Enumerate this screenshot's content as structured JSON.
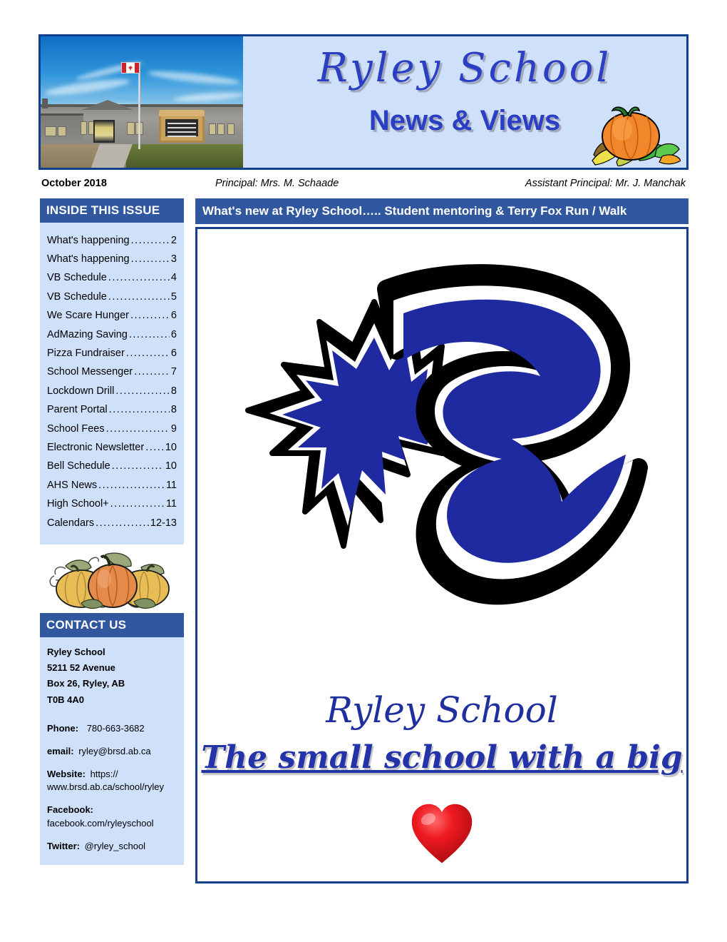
{
  "masthead": {
    "title": "Ryley School",
    "subtitle": "News & Views",
    "photo_alt": "ryley-school-building-photo",
    "pumpkin_alt": "autumn-pumpkin-clipart"
  },
  "byline": {
    "issue_date": "October 2018",
    "principal": "Principal: Mrs. M. Schaade",
    "assistant_principal": "Assistant Principal: Mr. J. Manchak"
  },
  "sidebar": {
    "toc_heading": "INSIDE THIS ISSUE",
    "toc": [
      {
        "label": "What's happening",
        "dots": "............",
        "page": "2"
      },
      {
        "label": "What's happening",
        "dots": "............",
        "page": "3"
      },
      {
        "label": "VB Schedule",
        "dots": "....................",
        "page": "4"
      },
      {
        "label": "VB Schedule",
        "dots": "....................",
        "page": "5"
      },
      {
        "label": "We Scare Hunger",
        "dots": "............",
        "page": "6"
      },
      {
        "label": "AdMazing Saving",
        "dots": "............",
        "page": "6"
      },
      {
        "label": "Pizza Fundraiser",
        "dots": ".............",
        "page": "6"
      },
      {
        "label": "School Messenger",
        "dots": "...........",
        "page": "7"
      },
      {
        "label": "Lockdown Drill",
        "dots": ".................",
        "page": "8"
      },
      {
        "label": "Parent Portal",
        "dots": "...................",
        "page": "8"
      },
      {
        "label": "School Fees",
        "dots": "....................",
        "page": "9"
      },
      {
        "label": "Electronic Newsletter",
        "dots": ".....",
        "page": "10"
      },
      {
        "label": "Bell Schedule",
        "dots": "................",
        "page": "10"
      },
      {
        "label": "AHS News",
        "dots": ".....................",
        "page": "11"
      },
      {
        "label": "High School+",
        "dots": ".................",
        "page": "11"
      },
      {
        "label": "Calendars",
        "dots": ".................",
        "page": "12-13"
      }
    ],
    "pumpkin_alt": "three-pumpkins-clipart",
    "contact_heading": "CONTACT US",
    "contact": {
      "school_name": "Ryley School",
      "street": "5211 52 Avenue",
      "box_city": "Box 26, Ryley,  AB",
      "postal": "T0B 4A0",
      "phone_label": "Phone:",
      "phone_value": "780-663-3682",
      "email_label": "email:",
      "email_value": "ryley@brsd.ab.ca",
      "website_label": "Website:",
      "website_value": "https://",
      "website_value2": "www.brsd.ab.ca/school/ryley",
      "facebook_label": "Facebook:",
      "facebook_value": "facebook.com/ryleyschool",
      "twitter_label": "Twitter:",
      "twitter_value": "@ryley_school"
    }
  },
  "main": {
    "heading": "What's new at Ryley School….. Student mentoring & Terry Fox Run / Walk",
    "logo_alt": "ryley-school-r-star-logo",
    "tagline_line1": "Ryley School",
    "tagline_line2": "The small school with a big",
    "heart_alt": "red-heart-graphic"
  },
  "colors": {
    "navy_bar": "#31589e",
    "border_blue": "#12408c",
    "panel_blue": "#cfe0fa",
    "logo_blue": "#1f2aa0",
    "heart_red": "#e8121a",
    "pumpkin_orange": "#f08a24"
  }
}
